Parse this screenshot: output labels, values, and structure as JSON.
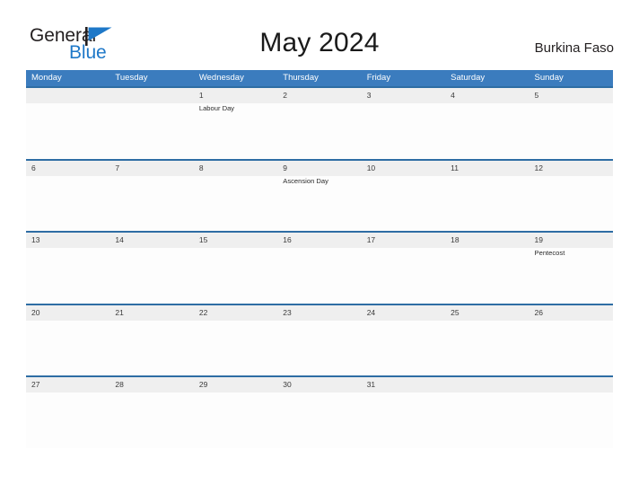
{
  "brand": {
    "word_general": "General",
    "word_blue": "Blue",
    "flag_icon": "triangle-flag-icon",
    "accent_color": "#1e78c8"
  },
  "header": {
    "title": "May 2024",
    "region": "Burkina Faso"
  },
  "theme": {
    "header_blue": "#3b7cbe",
    "row_divider_blue": "#2e6da4",
    "date_band_gray": "#efefef",
    "page_background": "#ffffff"
  },
  "calendar": {
    "month": "May",
    "year": "2024",
    "week_start": "Monday",
    "day_headers": [
      "Monday",
      "Tuesday",
      "Wednesday",
      "Thursday",
      "Friday",
      "Saturday",
      "Sunday"
    ],
    "weeks": [
      [
        {
          "date": "",
          "events": []
        },
        {
          "date": "",
          "events": []
        },
        {
          "date": "1",
          "events": [
            "Labour Day"
          ]
        },
        {
          "date": "2",
          "events": []
        },
        {
          "date": "3",
          "events": []
        },
        {
          "date": "4",
          "events": []
        },
        {
          "date": "5",
          "events": []
        }
      ],
      [
        {
          "date": "6",
          "events": []
        },
        {
          "date": "7",
          "events": []
        },
        {
          "date": "8",
          "events": []
        },
        {
          "date": "9",
          "events": [
            "Ascension Day"
          ]
        },
        {
          "date": "10",
          "events": []
        },
        {
          "date": "11",
          "events": []
        },
        {
          "date": "12",
          "events": []
        }
      ],
      [
        {
          "date": "13",
          "events": []
        },
        {
          "date": "14",
          "events": []
        },
        {
          "date": "15",
          "events": []
        },
        {
          "date": "16",
          "events": []
        },
        {
          "date": "17",
          "events": []
        },
        {
          "date": "18",
          "events": []
        },
        {
          "date": "19",
          "events": [
            "Pentecost"
          ]
        }
      ],
      [
        {
          "date": "20",
          "events": []
        },
        {
          "date": "21",
          "events": []
        },
        {
          "date": "22",
          "events": []
        },
        {
          "date": "23",
          "events": []
        },
        {
          "date": "24",
          "events": []
        },
        {
          "date": "25",
          "events": []
        },
        {
          "date": "26",
          "events": []
        }
      ],
      [
        {
          "date": "27",
          "events": []
        },
        {
          "date": "28",
          "events": []
        },
        {
          "date": "29",
          "events": []
        },
        {
          "date": "30",
          "events": []
        },
        {
          "date": "31",
          "events": []
        },
        {
          "date": "",
          "events": []
        },
        {
          "date": "",
          "events": []
        }
      ]
    ]
  }
}
